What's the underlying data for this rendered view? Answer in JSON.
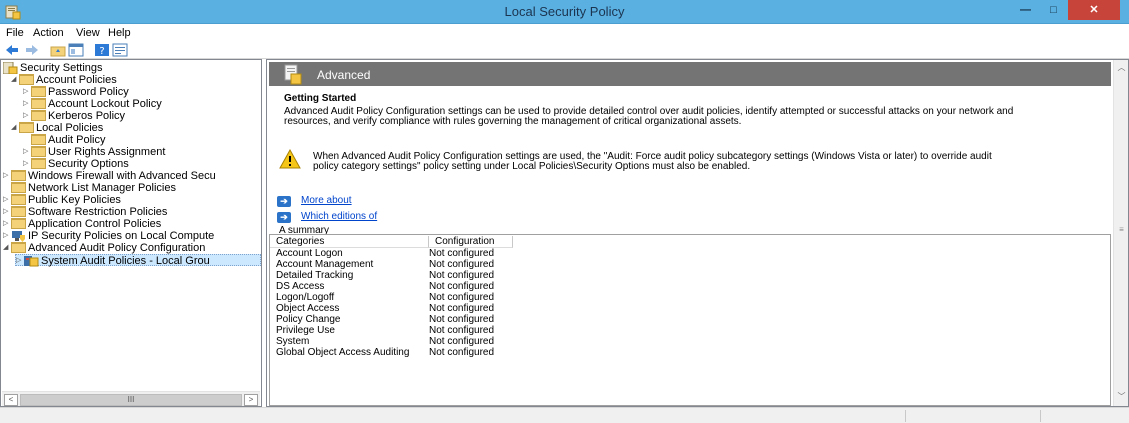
{
  "window": {
    "title": "Local Security Policy",
    "controls": {
      "minimize": "—",
      "maximize": "□",
      "close": "✕"
    }
  },
  "menubar": [
    "File",
    "Action",
    "View",
    "Help"
  ],
  "toolbar": [
    "back-arrow-icon",
    "forward-arrow-icon",
    "up-folder-icon",
    "show-hide-tree-icon",
    "help-icon",
    "properties-icon"
  ],
  "tree": {
    "root": "Security Settings",
    "items": [
      {
        "label": "Account Policies",
        "expander": "◢"
      },
      {
        "label": "Password Policy",
        "expander": "▷"
      },
      {
        "label": "Account Lockout Policy",
        "expander": "▷"
      },
      {
        "label": "Kerberos Policy",
        "expander": "▷"
      },
      {
        "label": "Local Policies",
        "expander": "◢"
      },
      {
        "label": "Audit Policy",
        "expander": ""
      },
      {
        "label": "User Rights Assignment",
        "expander": "▷"
      },
      {
        "label": "Security Options",
        "expander": "▷"
      },
      {
        "label": "Windows Firewall with Advanced Secu",
        "expander": "▷"
      },
      {
        "label": "Network List Manager Policies",
        "expander": ""
      },
      {
        "label": "Public Key Policies",
        "expander": "▷"
      },
      {
        "label": "Software Restriction Policies",
        "expander": "▷"
      },
      {
        "label": "Application Control Policies",
        "expander": "▷"
      },
      {
        "label": "IP Security Policies on Local Compute",
        "expander": "▷"
      },
      {
        "label": "Advanced Audit Policy Configuration",
        "expander": "◢"
      },
      {
        "label": "System Audit Policies - Local Grou",
        "expander": "▷"
      }
    ],
    "scroll_left": "<",
    "scroll_thumb": "III",
    "scroll_right": ">"
  },
  "details": {
    "banner_title": "Advanced",
    "heading": "Getting Started",
    "intro_line1": "Advanced Audit Policy Configuration settings can be used to provide detailed control over audit policies, identify attempted or successful attacks on your network and",
    "intro_line2": "resources, and verify compliance with rules governing the management of critical organizational assets.",
    "warning_line1": "When Advanced Audit Policy Configuration settings are used, the \"Audit: Force audit policy subcategory settings (Windows Vista or later) to override audit",
    "warning_line2": "policy category settings\" policy setting under Local Policies\\Security Options must also be enabled.",
    "link1": "More about",
    "link2": "Which editions of",
    "summary_label": "A summary",
    "table": {
      "headers": [
        "Categories",
        "Configuration"
      ],
      "rows": [
        [
          "Account Logon",
          "Not configured"
        ],
        [
          "Account Management",
          "Not configured"
        ],
        [
          "Detailed Tracking",
          "Not configured"
        ],
        [
          "DS Access",
          "Not configured"
        ],
        [
          "Logon/Logoff",
          "Not configured"
        ],
        [
          "Object Access",
          "Not configured"
        ],
        [
          "Policy Change",
          "Not configured"
        ],
        [
          "Privilege Use",
          "Not configured"
        ],
        [
          "System",
          "Not configured"
        ],
        [
          "Global Object Access Auditing",
          "Not configured"
        ]
      ]
    },
    "scroll_up": "︿",
    "scroll_down": "﹀",
    "scroll_mark": "≡"
  },
  "colors": {
    "titlebar": "#5bb0e2",
    "close_button": "#c7443a",
    "banner": "#747474",
    "selected_item": "#cce8ff",
    "link": "#0044cc"
  }
}
